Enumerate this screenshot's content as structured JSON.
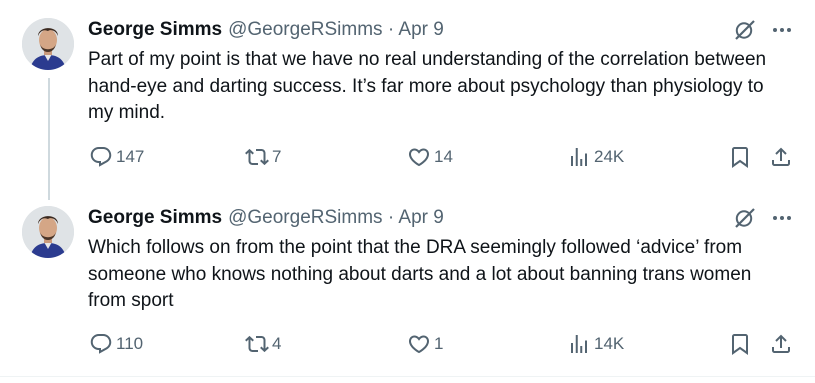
{
  "tweets": [
    {
      "author": "George Simms",
      "handle": "@GeorgeRSimms",
      "separator": "·",
      "date": "Apr 9",
      "text": "Part of my point is that we have no real understanding of the correlation between hand-eye and darting success. It’s far more about psychology than physiology to my mind.",
      "replies": "147",
      "reposts": "7",
      "likes": "14",
      "views": "24K"
    },
    {
      "author": "George Simms",
      "handle": "@GeorgeRSimms",
      "separator": "·",
      "date": "Apr 9",
      "text": "Which follows on from the point that the DRA seemingly followed ‘advice’ from someone who knows nothing about darts and a lot about banning trans women from sport",
      "replies": "110",
      "reposts": "4",
      "likes": "1",
      "views": "14K"
    }
  ],
  "icons": {
    "reply": "reply-icon",
    "repost": "repost-icon",
    "like": "like-icon",
    "views": "views-icon",
    "bookmark": "bookmark-icon",
    "share": "share-icon",
    "grok": "grok-icon",
    "more": "more-icon"
  },
  "colors": {
    "text": "#0f1419",
    "muted": "#536471",
    "thread_line": "#cfd9de",
    "background": "#ffffff"
  }
}
